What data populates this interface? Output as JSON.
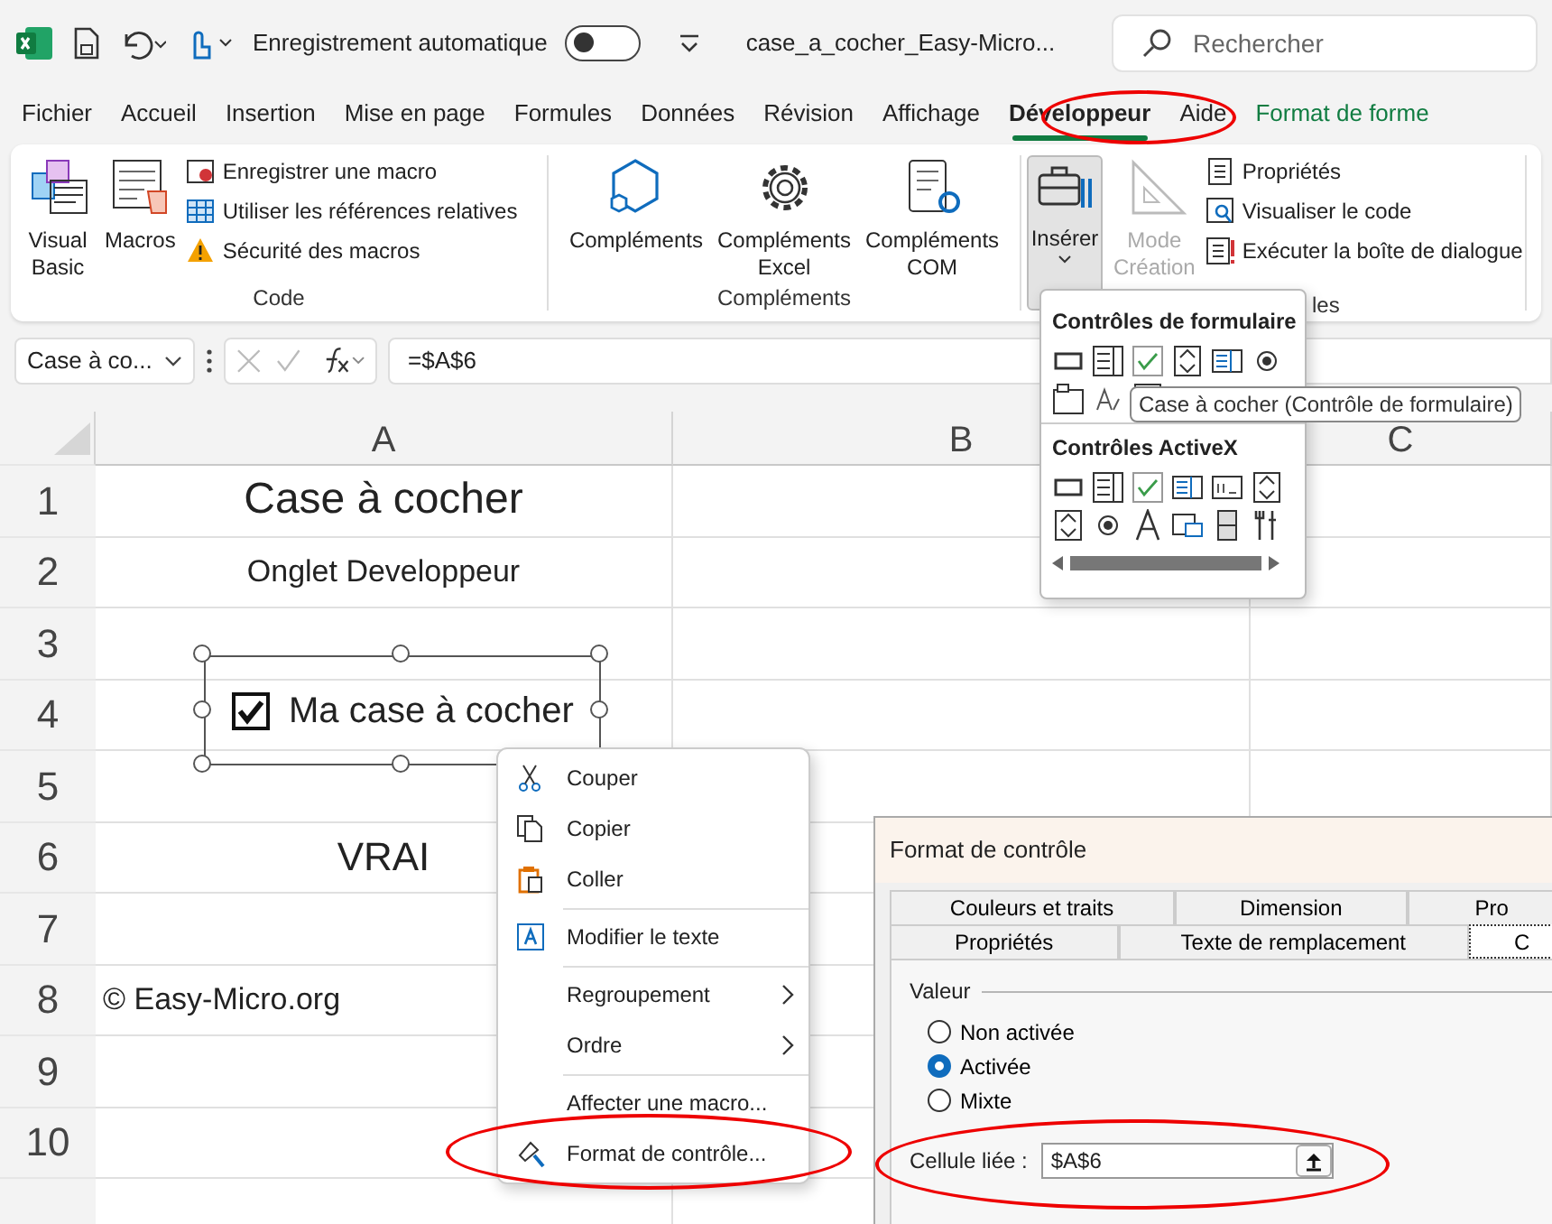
{
  "title_bar": {
    "autosave_label": "Enregistrement automatique",
    "autosave_on": false,
    "filename": "case_a_cocher_Easy-Micro...",
    "search_placeholder": "Rechercher"
  },
  "menu_tabs": [
    {
      "label": "Fichier",
      "selected": false,
      "kind": "normal"
    },
    {
      "label": "Accueil",
      "selected": false,
      "kind": "normal"
    },
    {
      "label": "Insertion",
      "selected": false,
      "kind": "normal"
    },
    {
      "label": "Mise en page",
      "selected": false,
      "kind": "normal"
    },
    {
      "label": "Formules",
      "selected": false,
      "kind": "normal"
    },
    {
      "label": "Données",
      "selected": false,
      "kind": "normal"
    },
    {
      "label": "Révision",
      "selected": false,
      "kind": "normal"
    },
    {
      "label": "Affichage",
      "selected": false,
      "kind": "normal"
    },
    {
      "label": "Développeur",
      "selected": true,
      "kind": "normal"
    },
    {
      "label": "Aide",
      "selected": false,
      "kind": "normal"
    },
    {
      "label": "Format de forme",
      "selected": false,
      "kind": "contextual"
    }
  ],
  "ribbon": {
    "code": {
      "label": "Code",
      "large": [
        {
          "label": "Visual Basic"
        },
        {
          "label": "Macros"
        }
      ],
      "small": [
        {
          "label": "Enregistrer une macro"
        },
        {
          "label": "Utiliser les références relatives"
        },
        {
          "label": "Sécurité des macros"
        }
      ]
    },
    "addins": {
      "label": "Compléments",
      "large": [
        {
          "label": "Compléments"
        },
        {
          "label": "Compléments Excel"
        },
        {
          "label": "Compléments COM"
        }
      ]
    },
    "controls": {
      "label": "les",
      "insert": {
        "label": "Insérer",
        "expanded": true
      },
      "design_mode": {
        "label": "Mode Création",
        "disabled": true
      },
      "small": [
        {
          "label": "Propriétés"
        },
        {
          "label": "Visualiser le code"
        },
        {
          "label": "Exécuter la boîte de dialogue"
        }
      ]
    }
  },
  "formula_bar": {
    "name_box": "Case à co...",
    "formula": "=$A$6"
  },
  "sheet": {
    "columns": [
      "A",
      "B",
      "C"
    ],
    "rows": [
      {
        "number": "1",
        "cell_a": "Case à cocher",
        "kind": "title"
      },
      {
        "number": "2",
        "cell_a": "Onglet Developpeur",
        "kind": "subtitle"
      },
      {
        "number": "3",
        "cell_a": "",
        "kind": "plain"
      },
      {
        "number": "4",
        "cell_a": "",
        "kind": "plain"
      },
      {
        "number": "5",
        "cell_a": "",
        "kind": "plain"
      },
      {
        "number": "6",
        "cell_a": "VRAI",
        "kind": "value"
      },
      {
        "number": "7",
        "cell_a": "",
        "kind": "plain"
      },
      {
        "number": "8",
        "cell_a": "© Easy-Micro.org",
        "kind": "credit"
      },
      {
        "number": "9",
        "cell_a": "",
        "kind": "plain"
      },
      {
        "number": "10",
        "cell_a": "",
        "kind": "plain"
      }
    ]
  },
  "checkbox_control": {
    "label": "Ma case à cocher",
    "checked": true
  },
  "context_menu": [
    {
      "kind": "item",
      "label": "Couper",
      "submenu": false
    },
    {
      "kind": "item",
      "label": "Copier",
      "submenu": false
    },
    {
      "kind": "item",
      "label": "Coller",
      "submenu": false
    },
    {
      "kind": "separator"
    },
    {
      "kind": "item",
      "label": "Modifier le texte",
      "submenu": false
    },
    {
      "kind": "separator"
    },
    {
      "kind": "item",
      "label": "Regroupement",
      "submenu": true
    },
    {
      "kind": "item",
      "label": "Ordre",
      "submenu": true
    },
    {
      "kind": "separator"
    },
    {
      "kind": "item",
      "label": "Affecter une macro...",
      "submenu": false
    },
    {
      "kind": "item",
      "label": "Format de contrôle...",
      "submenu": false
    }
  ],
  "insert_dropdown": {
    "form_title": "Contrôles de formulaire",
    "activex_title": "Contrôles ActiveX"
  },
  "tooltip": "Case à cocher (Contrôle de formulaire)",
  "dialog": {
    "title": "Format de contrôle",
    "tabs_back": [
      {
        "label": "Couleurs et traits",
        "selected": false
      },
      {
        "label": "Dimension",
        "selected": false
      },
      {
        "label": "Pro",
        "selected": false
      }
    ],
    "tabs_front": [
      {
        "label": "Propriétés",
        "selected": false
      },
      {
        "label": "Texte de remplacement",
        "selected": false
      },
      {
        "label": "C",
        "selected": true
      }
    ],
    "value_group": "Valeur",
    "radios": [
      {
        "label": "Non activée",
        "selected": false
      },
      {
        "label": "Activée",
        "selected": true
      },
      {
        "label": "Mixte",
        "selected": false
      }
    ],
    "linked_cell_label": "Cellule liée :",
    "linked_cell": "$A$6"
  }
}
